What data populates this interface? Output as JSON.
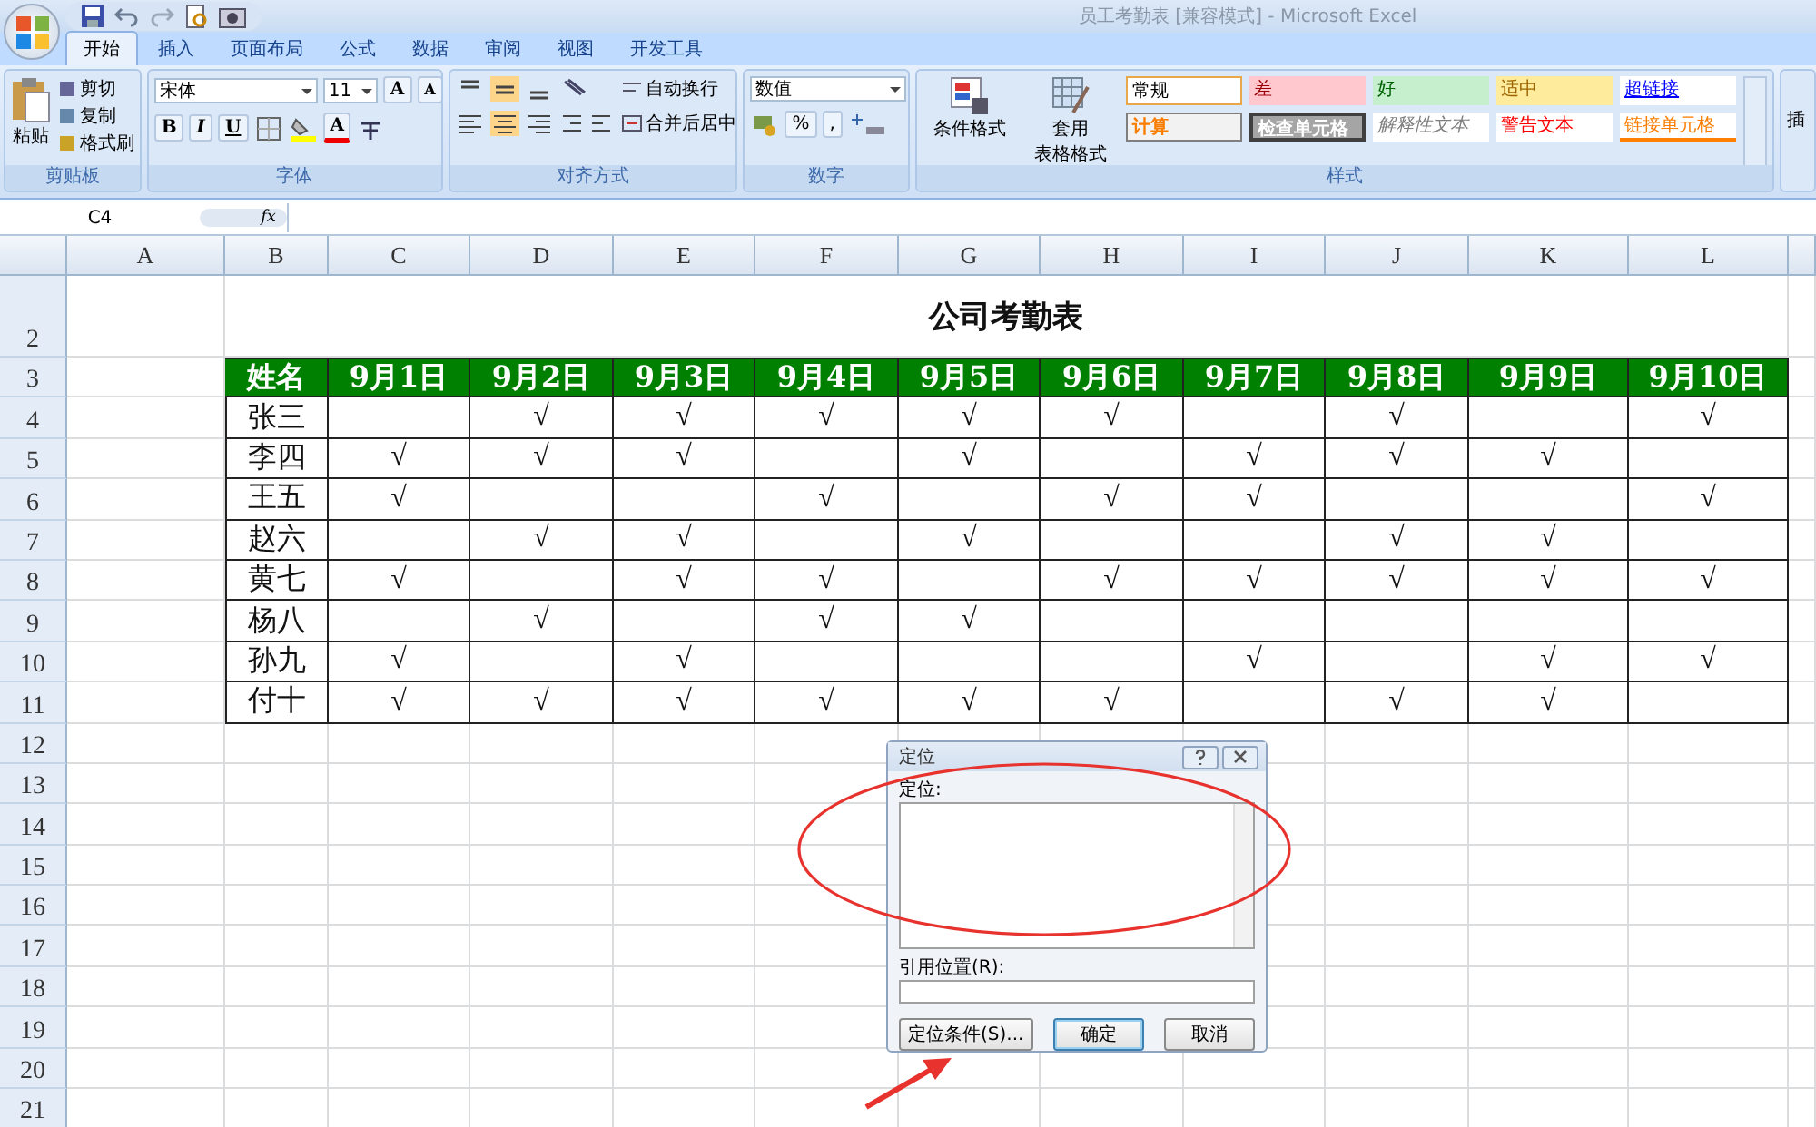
{
  "window": {
    "title": "员工考勤表  [兼容模式] - Microsoft Excel"
  },
  "tabs": [
    {
      "label": "开始",
      "selected": true
    },
    {
      "label": "插入",
      "selected": false
    },
    {
      "label": "页面布局",
      "selected": false
    },
    {
      "label": "公式",
      "selected": false
    },
    {
      "label": "数据",
      "selected": false
    },
    {
      "label": "审阅",
      "selected": false
    },
    {
      "label": "视图",
      "selected": false
    },
    {
      "label": "开发工具",
      "selected": false
    }
  ],
  "ribbon": {
    "clipboard": {
      "title": "剪贴板",
      "paste": "粘贴",
      "items": [
        "剪切",
        "复制",
        "格式刷"
      ]
    },
    "font": {
      "title": "字体",
      "name": "宋体",
      "size": "11",
      "size_buttons": [
        "A",
        "A"
      ],
      "styles": [
        "B",
        "I",
        "U"
      ],
      "color_letter": "A"
    },
    "alignment": {
      "title": "对齐方式",
      "wrap": "自动换行",
      "merge": "合并后居中"
    },
    "number": {
      "title": "数字",
      "format": "数值",
      "percent": "%",
      "comma": ","
    },
    "styles": {
      "title": "样式",
      "conditional": "条件格式",
      "table_format": [
        "套用",
        "表格格式"
      ],
      "cell_styles": [
        {
          "label": "常规",
          "kind": "normal"
        },
        {
          "label": "差",
          "kind": "bad"
        },
        {
          "label": "好",
          "kind": "good"
        },
        {
          "label": "适中",
          "kind": "neutral"
        },
        {
          "label": "超链接",
          "kind": "hyperlink"
        },
        {
          "label": "计算",
          "kind": "calc"
        },
        {
          "label": "检查单元格",
          "kind": "check"
        },
        {
          "label": "解释性文本",
          "kind": "explain"
        },
        {
          "label": "警告文本",
          "kind": "warning"
        },
        {
          "label": "链接单元格",
          "kind": "linked"
        }
      ]
    },
    "cells_cut": "插"
  },
  "formula_bar": {
    "name_box": "C4",
    "fx": "fx"
  },
  "sheet": {
    "column_letters": [
      "A",
      "B",
      "C",
      "D",
      "E",
      "F",
      "G",
      "H",
      "I",
      "J",
      "K",
      "L"
    ],
    "title_row": "2",
    "title": "公司考勤表",
    "header_row": "3",
    "header": [
      "姓名",
      "9月1日",
      "9月2日",
      "9月3日",
      "9月4日",
      "9月5日",
      "9月6日",
      "9月7日",
      "9月8日",
      "9月9日",
      "9月10日"
    ],
    "rows": [
      {
        "row": "4",
        "name": "张三",
        "cells": [
          {},
          {
            "value": "√"
          },
          {
            "value": "√"
          },
          {
            "value": "√"
          },
          {
            "value": "√"
          },
          {
            "value": "√"
          },
          {},
          {
            "value": "√"
          },
          {},
          {
            "value": "√"
          }
        ]
      },
      {
        "row": "5",
        "name": "李四",
        "cells": [
          {
            "value": "√"
          },
          {
            "value": "√"
          },
          {
            "value": "√"
          },
          {},
          {
            "value": "√"
          },
          {},
          {
            "value": "√"
          },
          {
            "value": "√"
          },
          {
            "value": "√"
          },
          {}
        ]
      },
      {
        "row": "6",
        "name": "王五",
        "cells": [
          {
            "value": "√"
          },
          {},
          {},
          {
            "value": "√"
          },
          {},
          {
            "value": "√"
          },
          {
            "value": "√"
          },
          {},
          {},
          {
            "value": "√"
          }
        ]
      },
      {
        "row": "7",
        "name": "赵六",
        "cells": [
          {},
          {
            "value": "√"
          },
          {
            "value": "√"
          },
          {},
          {
            "value": "√"
          },
          {},
          {},
          {
            "value": "√"
          },
          {
            "value": "√"
          },
          {}
        ]
      },
      {
        "row": "8",
        "name": "黄七",
        "cells": [
          {
            "value": "√"
          },
          {},
          {
            "value": "√"
          },
          {
            "value": "√"
          },
          {},
          {
            "value": "√"
          },
          {
            "value": "√"
          },
          {
            "value": "√"
          },
          {
            "value": "√"
          },
          {
            "value": "√"
          }
        ]
      },
      {
        "row": "9",
        "name": "杨八",
        "cells": [
          {},
          {
            "value": "√"
          },
          {},
          {
            "value": "√"
          },
          {
            "value": "√"
          },
          {},
          {},
          {},
          {},
          {}
        ]
      },
      {
        "row": "10",
        "name": "孙九",
        "cells": [
          {
            "value": "√"
          },
          {},
          {
            "value": "√"
          },
          {},
          {},
          {},
          {
            "value": "√"
          },
          {},
          {
            "value": "√"
          },
          {
            "value": "√"
          }
        ]
      },
      {
        "row": "11",
        "name": "付十",
        "cells": [
          {
            "value": "√"
          },
          {
            "value": "√"
          },
          {
            "value": "√"
          },
          {
            "value": "√"
          },
          {
            "value": "√"
          },
          {
            "value": "√"
          },
          {},
          {
            "value": "√"
          },
          {
            "value": "√"
          },
          {}
        ]
      }
    ],
    "empty_rows": [
      "12",
      "13",
      "14",
      "15",
      "16",
      "17",
      "18",
      "19",
      "20",
      "21"
    ]
  },
  "dialog": {
    "title": "定位",
    "list_label": "定位:",
    "ref_label": "引用位置(R):",
    "buttons": [
      {
        "label": "定位条件(S)...",
        "default": false
      },
      {
        "label": "确定",
        "default": true
      },
      {
        "label": "取消",
        "default": false
      }
    ]
  }
}
